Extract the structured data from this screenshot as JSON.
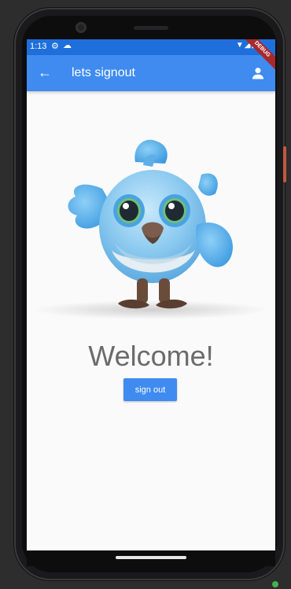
{
  "status_bar": {
    "time": "1:13",
    "gear_icon": "gear-icon",
    "cloud_icon": "cloud-icon",
    "right_icons": "▼◢▮"
  },
  "app_bar": {
    "back_icon": "←",
    "title": "lets signout",
    "person_icon": "person-icon"
  },
  "debug_banner": "DEBUG",
  "main": {
    "welcome": "Welcome!",
    "sign_out_label": "sign out"
  },
  "colors": {
    "app_bar": "#3f8bf0",
    "status_bar": "#1e6fdb",
    "background": "#fafafa",
    "welcome_text": "#6b6b6b",
    "debug": "#a8292d"
  }
}
